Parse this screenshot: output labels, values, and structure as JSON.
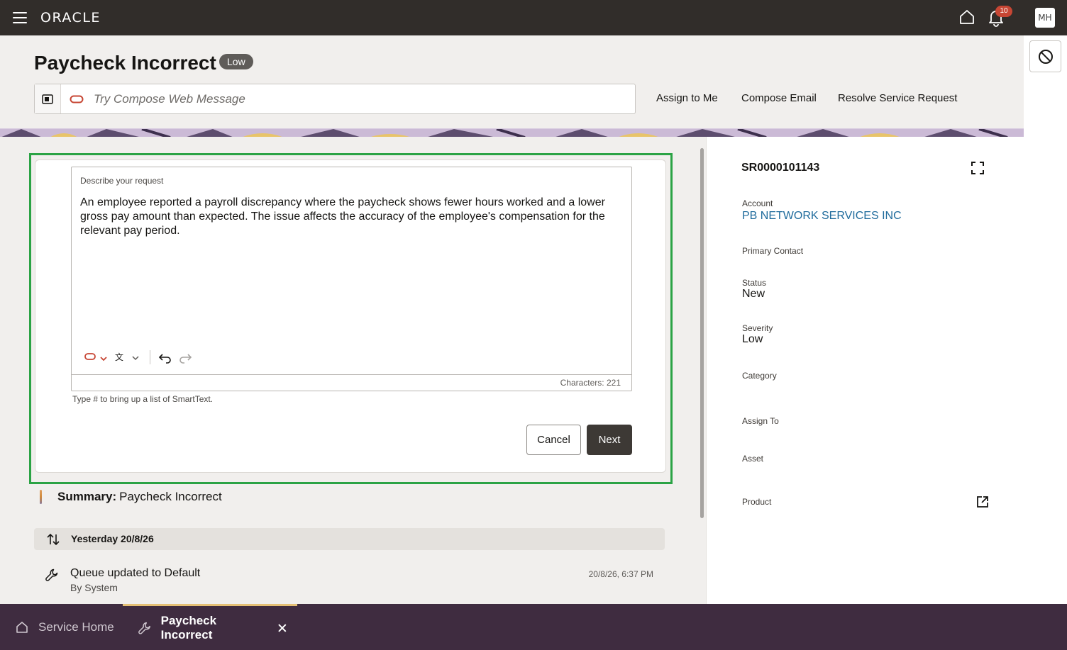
{
  "app": {
    "logo": "ORACLE",
    "notifications_count": "10",
    "user_initials": "MH"
  },
  "header": {
    "title": "Paycheck Incorrect",
    "severity_badge": "Low",
    "compose_placeholder": "Try Compose Web Message",
    "actions": {
      "assign": "Assign to Me",
      "email": "Compose Email",
      "resolve": "Resolve Service Request"
    }
  },
  "editor": {
    "label": "Describe your request",
    "text": "An employee reported a payroll discrepancy where the paycheck shows fewer hours worked and a lower gross pay amount than expected. The issue affects the accuracy of the employee's compensation for the relevant pay period.",
    "char_count": "Characters: 221",
    "hint": "Type # to bring up a list of SmartText.",
    "cancel_label": "Cancel",
    "next_label": "Next"
  },
  "summary": {
    "label": "Summary:",
    "value": "Paycheck Incorrect"
  },
  "timeline": {
    "date_group": "Yesterday 20/8/26",
    "items": [
      {
        "title": "Queue updated to Default",
        "by": "By System",
        "time": "20/8/26, 6:37 PM"
      }
    ]
  },
  "details": {
    "sr_number": "SR0000101143",
    "account_label": "Account",
    "account_value": "PB NETWORK SERVICES INC",
    "primary_contact_label": "Primary Contact",
    "status_label": "Status",
    "status_value": "New",
    "severity_label": "Severity",
    "severity_value": "Low",
    "category_label": "Category",
    "assign_to_label": "Assign To",
    "asset_label": "Asset",
    "product_label": "Product"
  },
  "bottom_tabs": {
    "home": "Service Home",
    "active": "Paycheck Incorrect"
  },
  "colors": {
    "topbar": "#312d2a",
    "highlight_frame": "#2ba345",
    "link": "#1f6b9c",
    "bottombar": "#3f2c40",
    "badge": "#c74634"
  }
}
